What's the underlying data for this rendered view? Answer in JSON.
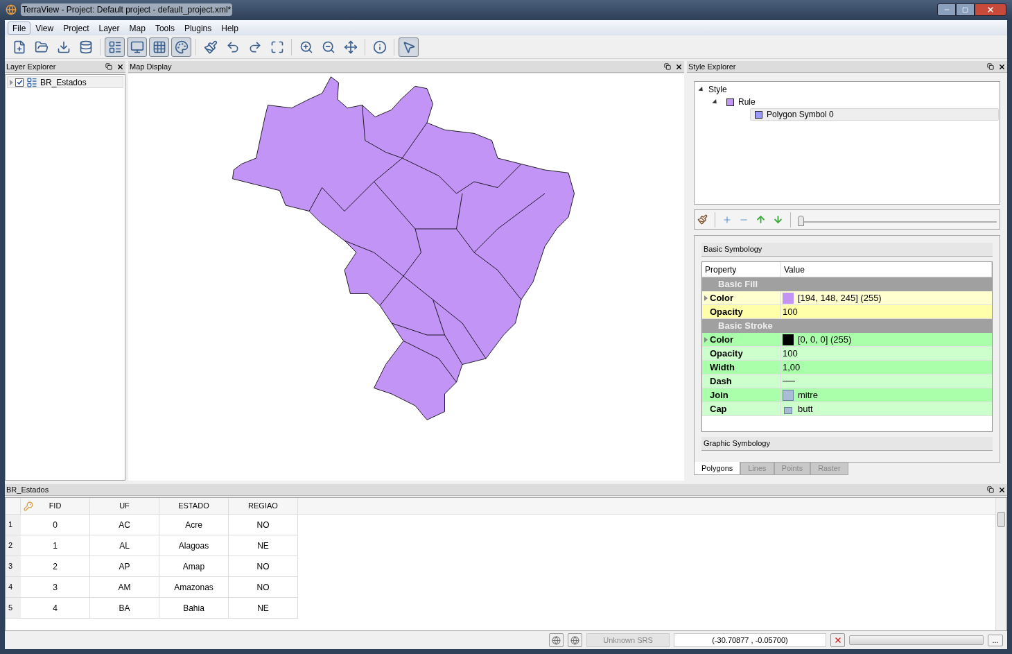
{
  "window": {
    "title": "TerraView - Project: Default project - default_project.xml*"
  },
  "menu": [
    {
      "label": "File",
      "selected": true
    },
    {
      "label": "View",
      "selected": false
    },
    {
      "label": "Project",
      "selected": false
    },
    {
      "label": "Layer",
      "selected": false
    },
    {
      "label": "Map",
      "selected": false
    },
    {
      "label": "Tools",
      "selected": false
    },
    {
      "label": "Plugins",
      "selected": false
    },
    {
      "label": "Help",
      "selected": false
    }
  ],
  "toolbar": [
    {
      "pressed": false
    },
    {
      "pressed": false
    },
    {
      "pressed": false
    },
    {
      "pressed": false
    },
    {
      "pressed": true
    },
    {
      "pressed": true
    },
    {
      "pressed": true
    },
    {
      "pressed": true
    },
    {
      "pressed": false
    },
    {
      "pressed": false
    },
    {
      "pressed": false
    },
    {
      "pressed": false
    },
    {
      "pressed": false
    },
    {
      "pressed": false
    },
    {
      "pressed": false
    },
    {
      "pressed": false
    },
    {
      "pressed": true
    }
  ],
  "layer_explorer": {
    "title": "Layer Explorer",
    "layers": [
      {
        "label": "BR_Estados",
        "checked": true,
        "expanded": false
      }
    ]
  },
  "map_display": {
    "title": "Map Display"
  },
  "style_explorer": {
    "title": "Style Explorer",
    "tree": [
      {
        "label": "Style",
        "expanded": true,
        "selected": false,
        "children": [
          {
            "label": "Rule",
            "color": "#c294f5",
            "expanded": true,
            "selected": false,
            "children": [
              {
                "label": "Polygon Symbol 0",
                "color": "#9999ff",
                "selected": true
              }
            ]
          }
        ]
      }
    ],
    "slider": {
      "level": 0.0
    },
    "basic_symbology": "Basic Symbology",
    "columns": [
      "Property",
      "Value"
    ],
    "sections": [
      {
        "title": "Basic Fill",
        "kind": "fill",
        "rows": [
          {
            "property": "Color",
            "kind": "color",
            "color": "#c294f5",
            "value": "[194, 148, 245] (255)",
            "expandable": true
          },
          {
            "property": "Opacity",
            "kind": "text",
            "value": "100",
            "expandable": false
          }
        ]
      },
      {
        "title": "Basic Stroke",
        "kind": "stroke",
        "rows": [
          {
            "property": "Color",
            "kind": "color",
            "color": "#000000",
            "value": "[0, 0, 0] (255)",
            "expandable": true
          },
          {
            "property": "Opacity",
            "kind": "text",
            "value": "100",
            "expandable": false
          },
          {
            "property": "Width",
            "kind": "text",
            "value": "1,00",
            "expandable": false
          },
          {
            "property": "Dash",
            "kind": "dash",
            "expandable": false
          },
          {
            "property": "Join",
            "kind": "join",
            "value": "mitre",
            "expandable": false
          },
          {
            "property": "Cap",
            "kind": "cap",
            "value": "butt",
            "expandable": false
          }
        ]
      }
    ],
    "graphic_symbology": "Graphic Symbology",
    "tabs": [
      {
        "label": "Polygons",
        "selected": true
      },
      {
        "label": "Lines",
        "selected": false
      },
      {
        "label": "Points",
        "selected": false
      },
      {
        "label": "Raster",
        "selected": false
      }
    ]
  },
  "table": {
    "title": "BR_Estados",
    "columns": [
      "FID",
      "UF",
      "ESTADO",
      "REGIAO"
    ],
    "rows": [
      {
        "number": "1",
        "cells": [
          "0",
          "AC",
          "Acre",
          "NO"
        ]
      },
      {
        "number": "2",
        "cells": [
          "1",
          "AL",
          "Alagoas",
          "NE"
        ]
      },
      {
        "number": "3",
        "cells": [
          "2",
          "AP",
          "Amap",
          "NO"
        ]
      },
      {
        "number": "4",
        "cells": [
          "3",
          "AM",
          "Amazonas",
          "NO"
        ]
      },
      {
        "number": "5",
        "cells": [
          "4",
          "BA",
          "Bahia",
          "NE"
        ]
      }
    ]
  },
  "status_bar": {
    "srs": "Unknown SRS",
    "coordinates": "(-30.70877 , -0.05700)",
    "more": "...",
    "progress": {
      "level": 0.0
    }
  }
}
